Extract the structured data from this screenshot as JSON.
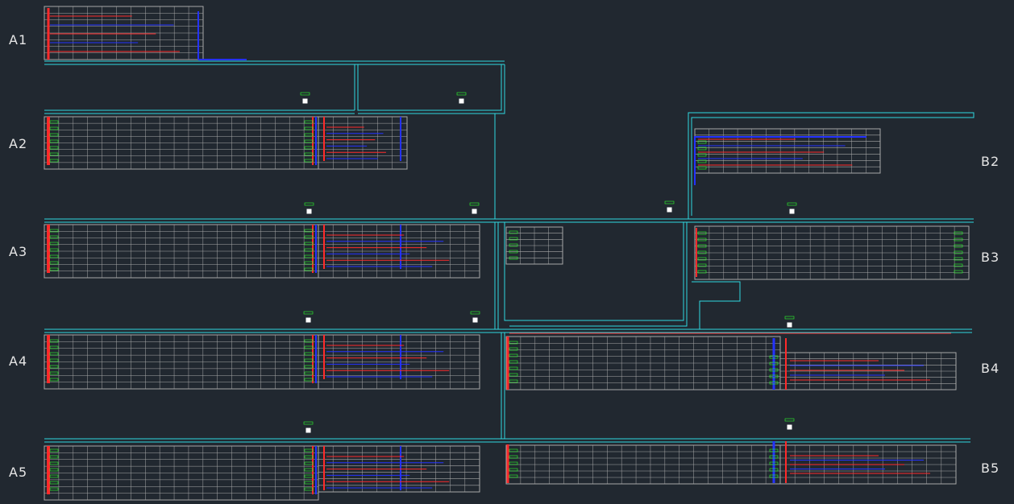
{
  "drawing": {
    "background": "#212830",
    "colors": {
      "grid": "#a8a8a8",
      "pipe_main": "#2fd8e0",
      "pipe_hot": "#ff2a2a",
      "pipe_cold": "#2432ff",
      "tags": "#2cff2c",
      "riser": "#ffffff",
      "labels": "#e6e6e6"
    },
    "zones": [
      {
        "id": "A1",
        "label": "A1"
      },
      {
        "id": "A2",
        "label": "A2"
      },
      {
        "id": "A3",
        "label": "A3"
      },
      {
        "id": "A4",
        "label": "A4"
      },
      {
        "id": "A5",
        "label": "A5"
      },
      {
        "id": "B2",
        "label": "B2"
      },
      {
        "id": "B3",
        "label": "B3"
      },
      {
        "id": "B4",
        "label": "B4"
      },
      {
        "id": "B5",
        "label": "B5"
      }
    ]
  }
}
